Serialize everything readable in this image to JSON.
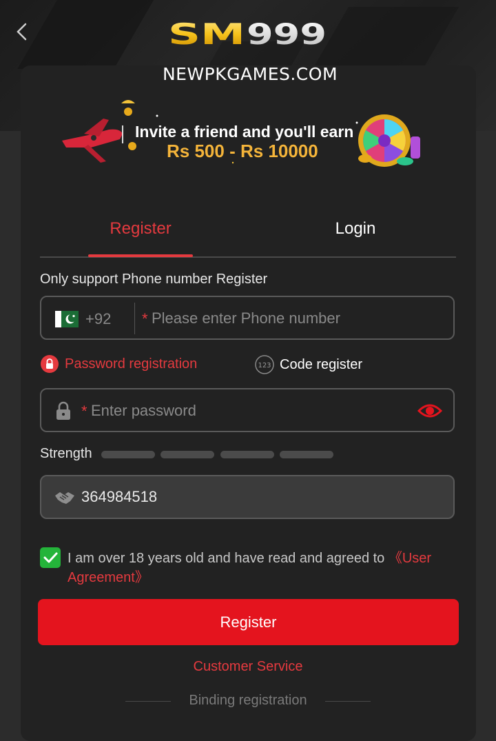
{
  "header": {
    "back_icon": "chevron-left-icon",
    "logo_text": "SM999",
    "watermark": "NEWPKGAMES.COM"
  },
  "banner": {
    "line1": "Invite a friend and you'll earn",
    "line2": "Rs 500 - Rs 10000"
  },
  "tabs": [
    {
      "label": "Register",
      "active": true
    },
    {
      "label": "Login",
      "active": false
    }
  ],
  "form": {
    "hint": "Only support Phone number Register",
    "phone": {
      "country_code": "+92",
      "flag_icon": "pakistan-flag-icon",
      "required_mark": "*",
      "placeholder": "Please enter Phone number",
      "value": ""
    },
    "modes": {
      "password_label": "Password registration",
      "code_label": "Code register",
      "code_icon_text": "123"
    },
    "password": {
      "required_mark": "*",
      "placeholder": "Enter password",
      "value": ""
    },
    "strength_label": "Strength",
    "strength_segments": 4,
    "invite_code": "364984518",
    "agreement": {
      "checked": true,
      "text": "I am over 18 years old and have read and agreed to ",
      "link": "《User Agreement》"
    },
    "submit_label": "Register"
  },
  "footer": {
    "customer_service": "Customer Service",
    "binding_registration": "Binding registration"
  },
  "colors": {
    "accent_red": "#e53a3f",
    "button_red": "#e4141e",
    "check_green": "#24b43a",
    "banner_gold": "#f4b43a",
    "card_bg": "#222222"
  }
}
